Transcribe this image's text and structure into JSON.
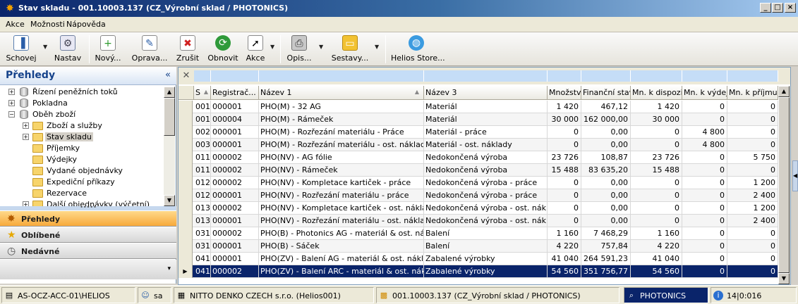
{
  "window": {
    "title": "Stav skladu - 001.10003.137 (CZ_Výrobní sklad / PHOTONICS)",
    "controls": [
      "_",
      "□",
      "×"
    ]
  },
  "menu": [
    "Akce",
    "Možnosti",
    "Nápověda"
  ],
  "toolbar": [
    {
      "label": "Schovej",
      "icon": "hide-panel-icon"
    },
    {
      "label": "Nastav",
      "icon": "settings-icon"
    },
    {
      "label": "Nový...",
      "icon": "new-document-icon"
    },
    {
      "label": "Oprava...",
      "icon": "edit-icon"
    },
    {
      "label": "Zrušit",
      "icon": "delete-icon"
    },
    {
      "label": "Obnovit",
      "icon": "refresh-icon"
    },
    {
      "label": "Akce",
      "icon": "action-cursor-icon"
    },
    {
      "label": "Opis...",
      "icon": "printer-icon"
    },
    {
      "label": "Sestavy...",
      "icon": "reports-folder-icon"
    },
    {
      "label": "Helios Store...",
      "icon": "globe-icon"
    }
  ],
  "sidebar": {
    "title": "Přehledy",
    "collapse": "«",
    "tree": [
      {
        "label": "Řízení peněžních toků",
        "type": "db",
        "level": 0,
        "expander": "+"
      },
      {
        "label": "Pokladna",
        "type": "db",
        "level": 0,
        "expander": "+"
      },
      {
        "label": "Oběh zboží",
        "type": "db",
        "level": 0,
        "expander": "−"
      },
      {
        "label": "Zboží a služby",
        "type": "folder",
        "level": 1,
        "expander": "+"
      },
      {
        "label": "Stav skladu",
        "type": "folder",
        "level": 1,
        "expander": "+",
        "selected": true
      },
      {
        "label": "Příjemky",
        "type": "folder",
        "level": 1
      },
      {
        "label": "Výdejky",
        "type": "folder",
        "level": 1
      },
      {
        "label": "Vydané objednávky",
        "type": "folder",
        "level": 1
      },
      {
        "label": "Expediční příkazy",
        "type": "folder",
        "level": 1
      },
      {
        "label": "Rezervace",
        "type": "folder",
        "level": 1
      },
      {
        "label": "Další objednávky (výčetní)",
        "type": "folder",
        "level": 1,
        "expander": "+"
      }
    ],
    "nav": [
      {
        "label": "Přehledy",
        "icon": "overviews-icon",
        "active": true
      },
      {
        "label": "Oblíbené",
        "icon": "star-icon",
        "active": false
      },
      {
        "label": "Nedávné",
        "icon": "clock-icon",
        "active": false
      }
    ],
    "nav_more": "▾"
  },
  "grid": {
    "columns": [
      "S",
      "Registrač...",
      "Název 1",
      "Název 3",
      "Množství",
      "Finanční stav",
      "Mn. k dispozici",
      "Mn. k výdeji",
      "Mn. k příjmu"
    ],
    "rows": [
      [
        "001",
        "000001",
        "PHO(M) - 32 AG",
        "Materiál",
        "1 420",
        "467,12",
        "1 420",
        "0",
        "0"
      ],
      [
        "001",
        "000004",
        "PHO(M) - Rámeček",
        "Materiál",
        "30 000",
        "162 000,00",
        "30 000",
        "0",
        "0"
      ],
      [
        "002",
        "000001",
        "PHO(M) - Rozřezání materiálu - Práce",
        "Materiál - práce",
        "0",
        "0,00",
        "0",
        "4 800",
        "0"
      ],
      [
        "003",
        "000001",
        "PHO(M) - Rozřezání materiálu - ost. náklady",
        "Materiál - ost. náklady",
        "0",
        "0,00",
        "0",
        "4 800",
        "0"
      ],
      [
        "011",
        "000002",
        "PHO(NV) - AG fólie",
        "Nedokončená výroba",
        "23 726",
        "108,87",
        "23 726",
        "0",
        "5 750"
      ],
      [
        "011",
        "000002",
        "PHO(NV) - Rámeček",
        "Nedokončená výroba",
        "15 488",
        "83 635,20",
        "15 488",
        "0",
        "0"
      ],
      [
        "012",
        "000002",
        "PHO(NV) - Kompletace kartiček - práce",
        "Nedokončená výroba - práce",
        "0",
        "0,00",
        "0",
        "0",
        "1 200"
      ],
      [
        "012",
        "000001",
        "PHO(NV) - Rozřezání materiálu - práce",
        "Nedokončená výroba - práce",
        "0",
        "0,00",
        "0",
        "0",
        "2 400"
      ],
      [
        "013",
        "000002",
        "PHO(NV) - Kompletace kartiček - ost. náklady",
        "Nedokončená výroba - ost. náklady",
        "0",
        "0,00",
        "0",
        "0",
        "1 200"
      ],
      [
        "013",
        "000001",
        "PHO(NV) - Rozřezání materiálu - ost. náklady",
        "Nedokončená výroba - ost. náklady",
        "0",
        "0,00",
        "0",
        "0",
        "2 400"
      ],
      [
        "031",
        "000002",
        "PHO(B) - Photonics AG - materiál & ost. náklady",
        "Balení",
        "1 160",
        "7 468,29",
        "1 160",
        "0",
        "0"
      ],
      [
        "031",
        "000001",
        "PHO(B) - Sáček",
        "Balení",
        "4 220",
        "757,84",
        "4 220",
        "0",
        "0"
      ],
      [
        "041",
        "000001",
        "PHO(ZV) - Balení AG - materiál & ost. náklady",
        "Zabalené výrobky",
        "41 040",
        "264 591,23",
        "41 040",
        "0",
        "0"
      ],
      [
        "041",
        "000002",
        "PHO(ZV) - Balení ARC - materiál & ost. náklady",
        "Zabalené výrobky",
        "54 560",
        "351 756,77",
        "54 560",
        "0",
        "0"
      ]
    ],
    "selected_row": 13
  },
  "statusbar": [
    {
      "text": "AS-OCZ-ACC-01\\HELIOS",
      "icon": "server-icon"
    },
    {
      "text": "sa",
      "icon": "user-icon"
    },
    {
      "text": "NITTO DENKO CZECH s.r.o. (Helios001)",
      "icon": "company-icon"
    },
    {
      "text": "001.10003.137 (CZ_Výrobní sklad / PHOTONICS)",
      "icon": "warehouse-icon"
    },
    {
      "text": "PHOTONICS",
      "icon": "search-icon"
    },
    {
      "text": "14|0:016",
      "icon": "info-icon"
    }
  ]
}
